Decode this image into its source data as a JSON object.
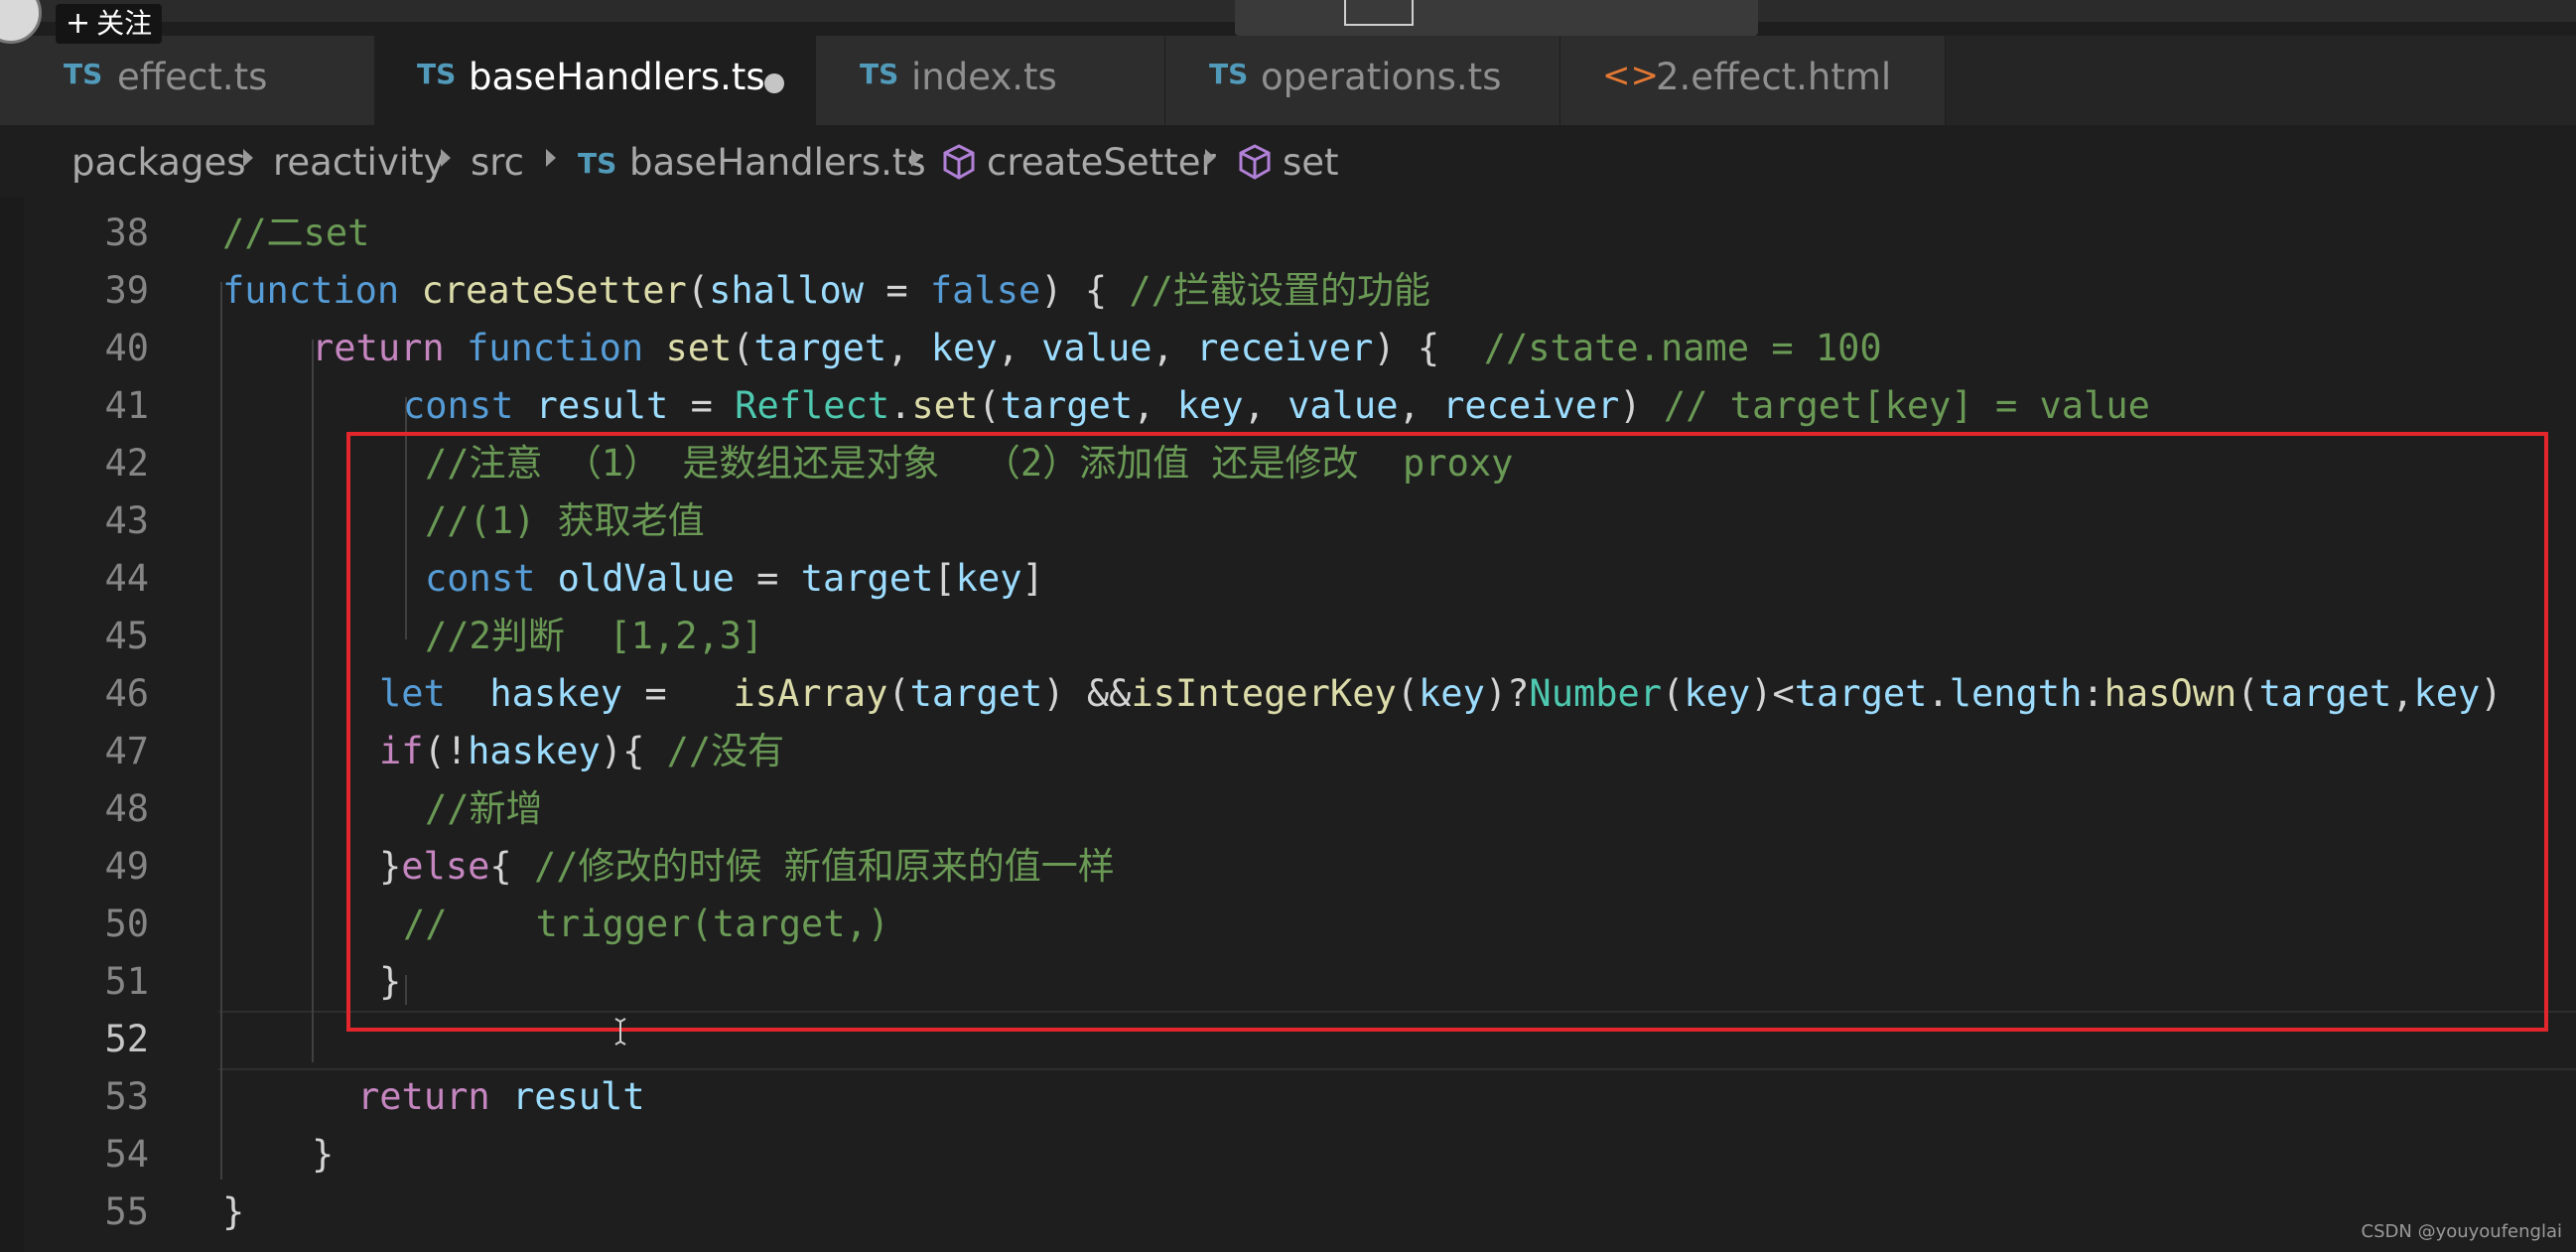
{
  "overlay": {
    "follow_label": "关注",
    "plus": "+"
  },
  "tabs": [
    {
      "icon": "TS",
      "label": "effect.ts",
      "active": false
    },
    {
      "icon": "TS",
      "label": "baseHandlers.ts",
      "active": true,
      "modified": true
    },
    {
      "icon": "TS",
      "label": "index.ts",
      "active": false
    },
    {
      "icon": "TS",
      "label": "operations.ts",
      "active": false
    },
    {
      "icon": "<>",
      "label": "2.effect.html",
      "active": false
    }
  ],
  "breadcrumb": [
    {
      "label": "packages"
    },
    {
      "label": "reactivity"
    },
    {
      "label": "src"
    },
    {
      "icon": "TS",
      "label": "baseHandlers.ts"
    },
    {
      "icon": "cube-icon",
      "label": "createSetter"
    },
    {
      "icon": "cube-icon",
      "label": "set"
    }
  ],
  "editor": {
    "line_numbers": [
      "38",
      "39",
      "40",
      "41",
      "42",
      "43",
      "44",
      "45",
      "46",
      "47",
      "48",
      "49",
      "50",
      "51",
      "52",
      "53",
      "54",
      "55"
    ],
    "current_line": "52",
    "lines": [
      "//二set",
      "function createSetter(shallow = false) { //拦截设置的功能",
      "return function set(target, key, value, receiver) {  //state.name = 100",
      "const result = Reflect.set(target, key, value, receiver) // target[key] = value",
      "//注意 （1） 是数组还是对象  （2）添加值 还是修改  proxy",
      "//(1) 获取老值",
      "const oldValue = target[key]",
      "//2判断  [1,2,3]",
      "let  haskey =   isArray(target) &&isIntegerKey(key)?Number(key)<target.length:hasOwn(target,key)",
      "if(!haskey){ //没有",
      "//新增",
      "}else{ //修改的时候 新值和原来的值一样",
      "//    trigger(target,)",
      "}",
      "",
      "return result",
      "}",
      "}"
    ]
  },
  "watermark": "CSDN @youyoufenglai",
  "colors": {
    "background": "#1e1e1e",
    "comment": "#6a9955",
    "keyword": "#569cd6",
    "function": "#dcdcaa",
    "variable": "#9cdcfe",
    "highlight_box": "#e3262b",
    "ts_icon": "#519aba"
  }
}
